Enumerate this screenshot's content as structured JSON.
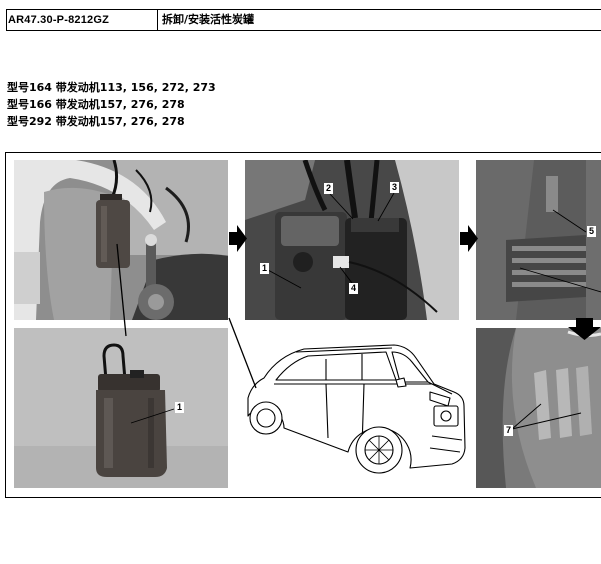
{
  "header": {
    "code": "AR47.30-P-8212GZ",
    "title": "拆卸/安装活性炭罐"
  },
  "applicability": [
    "型号164 带发动机113, 156, 272, 273",
    "型号166 带发动机157, 276, 278",
    "型号292 带发动机157, 276, 278"
  ],
  "figure": {
    "callouts": {
      "inset_canister": "1",
      "engine_bay": [
        "1",
        "2",
        "3",
        "4"
      ],
      "bracket": "5",
      "wheel_arch": "7"
    }
  },
  "icons": {
    "step_arrow": "arrow-right-icon",
    "down_arrow": "arrow-down-icon"
  },
  "colors": {
    "text": "#000000",
    "page": "#ffffff"
  }
}
